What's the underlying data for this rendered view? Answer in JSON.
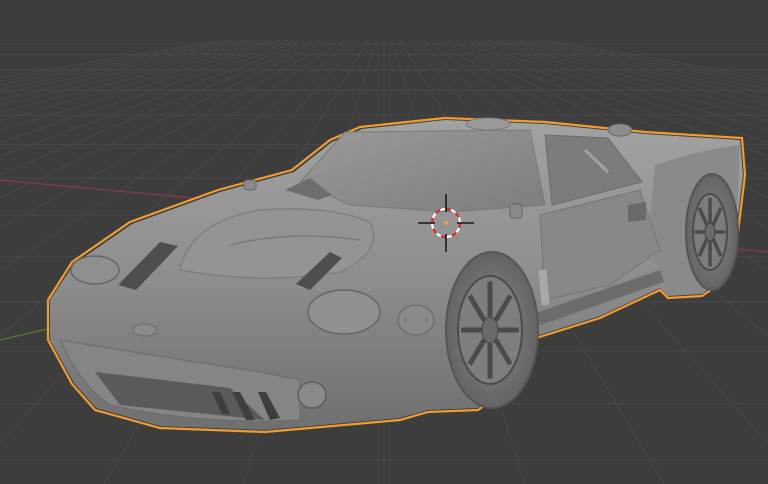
{
  "viewport": {
    "background_color": "#3d3d3d",
    "grid_color": "#474747",
    "x_axis_color": "#8a3a45",
    "y_axis_color": "#5b7a35",
    "selection_outline_color": "#f29b2e",
    "body_color": "#8e8e8e",
    "cursor_ring_colors": [
      "#e02727",
      "#ffffff"
    ],
    "cursor_crosshair_color": "#000000"
  },
  "scene": {
    "object": "car-mesh",
    "selected": true,
    "wheels": [
      "front-wheel",
      "rear-wheel"
    ]
  }
}
